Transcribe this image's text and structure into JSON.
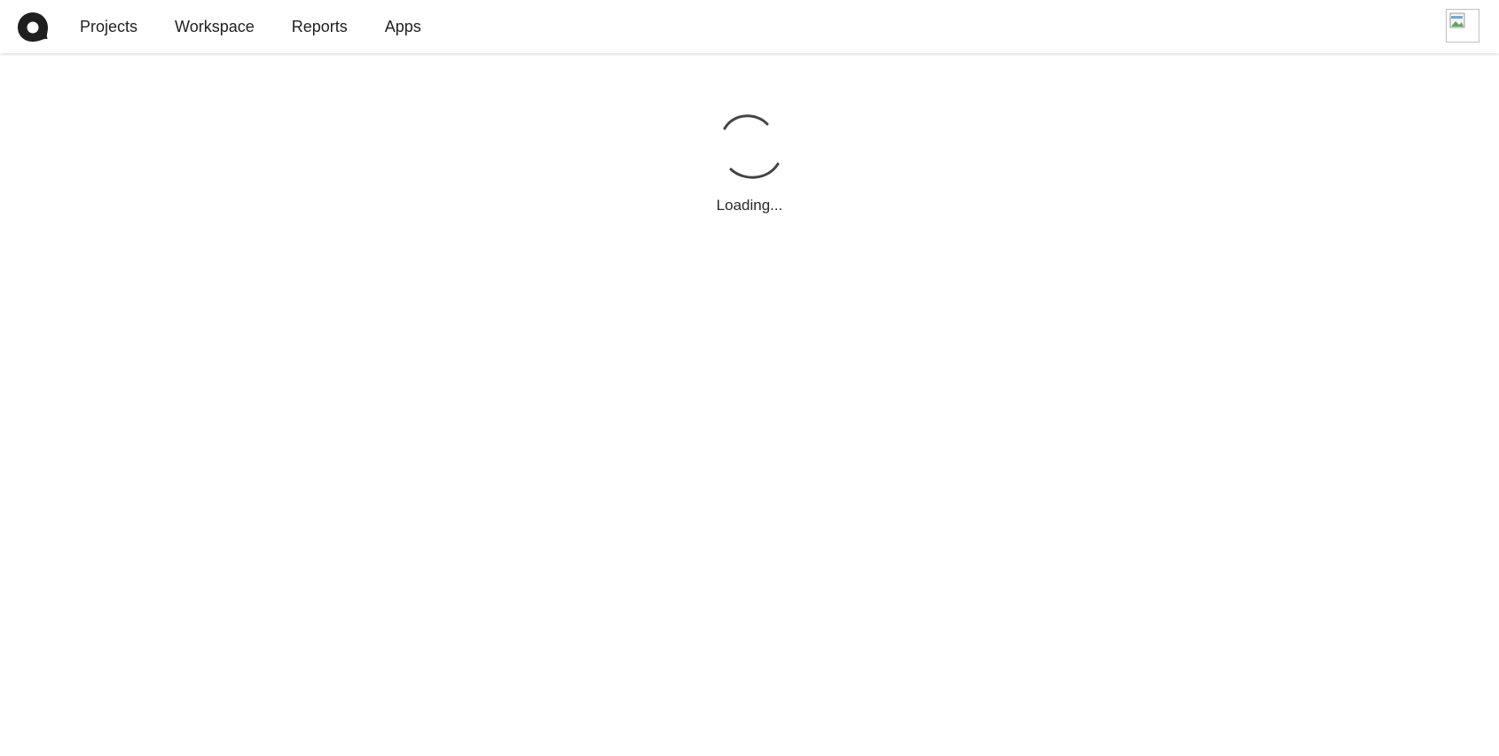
{
  "header": {
    "nav": [
      {
        "label": "Projects"
      },
      {
        "label": "Workspace"
      },
      {
        "label": "Reports"
      },
      {
        "label": "Apps"
      }
    ]
  },
  "loading": {
    "text": "Loading..."
  },
  "colors": {
    "text": "#222222",
    "spinner": "#444444",
    "logo": "#1f1f1f",
    "avatar_border": "#bfbfbf"
  },
  "icons": {
    "logo": "app-logo",
    "avatar": "broken-image-avatar",
    "spinner": "loading-spinner"
  }
}
